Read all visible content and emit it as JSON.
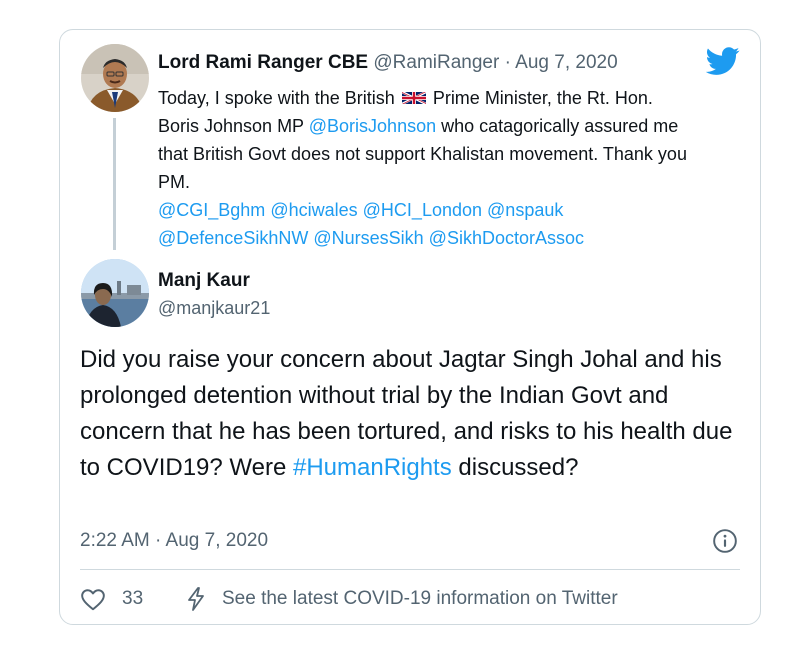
{
  "parent_tweet": {
    "author_name": "Lord Rami Ranger CBE",
    "handle": "@RamiRanger",
    "separator": " · ",
    "date": "Aug 7, 2020",
    "text_1": "Today, I spoke with the British",
    "flag_icon": "uk-flag-icon",
    "text_2": "Prime Minister, the Rt. Hon. Boris Johnson MP",
    "mention_boris": "@BorisJohnson",
    "text_3": "who catagorically assured me that British Govt does not support Khalistan movement. Thank you PM.",
    "mentions": [
      "@CGI_Bghm",
      "@hciwales",
      "@HCI_London",
      "@nspauk",
      "@DefenceSikhNW",
      "@NursesSikh",
      "@SikhDoctorAssoc"
    ]
  },
  "reply_tweet": {
    "author_name": "Manj Kaur",
    "handle": "@manjkaur21",
    "text_1": "Did you raise your concern about Jagtar Singh Johal and his prolonged detention without trial by the Indian Govt and concern that he has been tortured, and risks to his health due to COVID19? Were",
    "hashtag": "#HumanRights",
    "text_2": "discussed?",
    "timestamp": "2:22 AM · Aug 7, 2020"
  },
  "footer": {
    "like_count": "33",
    "covid_info": "See the latest COVID-19 information on Twitter"
  },
  "icons": {
    "logo": "twitter-bird-icon",
    "info": "info-icon",
    "like": "heart-icon",
    "covid": "lightning-icon"
  },
  "colors": {
    "link": "#1d9bf0",
    "secondary_text": "#536471",
    "border": "#cfd9de",
    "twitter_blue": "#1d9bf0"
  }
}
